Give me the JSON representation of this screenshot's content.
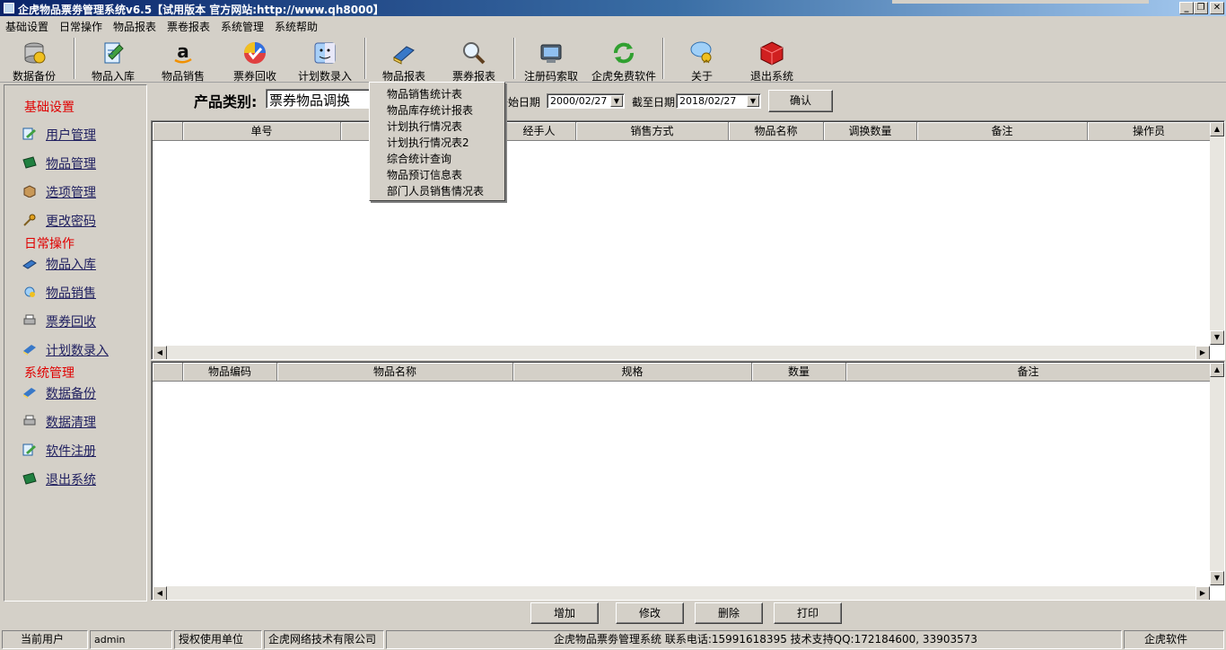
{
  "window": {
    "title": "企虎物品票劵管理系统v6.5【试用版本 官方网站:http://www.qh8000】",
    "controls": [
      "_",
      "❐",
      "✕"
    ]
  },
  "menubar": [
    "基础设置",
    "日常操作",
    "物品报表",
    "票卷报表",
    "系统管理",
    "系统帮助"
  ],
  "toolbar": [
    {
      "label": "数据备份",
      "icon": "database-backup-icon"
    },
    {
      "label": "物品入库",
      "icon": "stock-in-icon"
    },
    {
      "label": "物品销售",
      "icon": "amazon-sales-icon"
    },
    {
      "label": "票券回收",
      "icon": "ticket-recycle-icon"
    },
    {
      "label": "计划数录入",
      "icon": "finder-plan-icon"
    },
    {
      "label": "物品报表",
      "icon": "book-report-icon"
    },
    {
      "label": "票券报表",
      "icon": "magnifier-report-icon"
    },
    {
      "label": "注册码索取",
      "icon": "register-key-icon"
    },
    {
      "label": "企虎免费软件",
      "icon": "refresh-green-icon"
    },
    {
      "label": "关于",
      "icon": "about-chat-icon"
    },
    {
      "label": "退出系统",
      "icon": "exit-red-box-icon"
    }
  ],
  "sidebar": {
    "sections": [
      {
        "title": "基础设置",
        "items": [
          {
            "label": "用户管理",
            "icon": "user-admin-icon"
          },
          {
            "label": "物品管理",
            "icon": "goods-manage-icon"
          },
          {
            "label": "选项管理",
            "icon": "box-options-icon"
          },
          {
            "label": "更改密码",
            "icon": "key-password-icon"
          }
        ]
      },
      {
        "title": "日常操作",
        "items": [
          {
            "label": "物品入库",
            "icon": "stock-in-small-icon"
          },
          {
            "label": "物品销售",
            "icon": "sales-small-icon"
          },
          {
            "label": "票券回收",
            "icon": "printer-recycle-icon"
          },
          {
            "label": "计划数录入",
            "icon": "plan-entry-icon"
          }
        ]
      },
      {
        "title": "系统管理",
        "items": [
          {
            "label": "数据备份",
            "icon": "backup-small-icon"
          },
          {
            "label": "数据清理",
            "icon": "printer-clean-icon"
          },
          {
            "label": "软件注册",
            "icon": "register-small-icon"
          },
          {
            "label": "退出系统",
            "icon": "exit-small-icon"
          }
        ]
      }
    ]
  },
  "filter": {
    "category_label": "产品类别:",
    "category_value": "票券物品调换",
    "start_label": "开始日期",
    "start_value": "2000/02/27",
    "end_label": "截至日期",
    "end_value": "2018/02/27",
    "confirm_label": "确认"
  },
  "popup_menu": [
    "物品销售统计表",
    "物品库存统计报表",
    "计划执行情况表",
    "计划执行情况表2",
    "综合统计查询",
    "物品预订信息表",
    "部门人员销售情况表"
  ],
  "top_grid": {
    "columns": [
      "",
      "单号",
      "",
      "经手人",
      "销售方式",
      "物品名称",
      "调换数量",
      "备注",
      "操作员"
    ]
  },
  "bottom_grid": {
    "columns": [
      "",
      "物品编码",
      "物品名称",
      "规格",
      "数量",
      "备注"
    ]
  },
  "actions": [
    "增加",
    "修改",
    "删除",
    "打印"
  ],
  "statusbar": [
    "当前用户",
    "admin",
    "授权使用单位",
    "企虎网络技术有限公司",
    "企虎物品票劵管理系统  联系电话:15991618395  技术支持QQ:172184600, 33903573",
    "企虎软件"
  ]
}
